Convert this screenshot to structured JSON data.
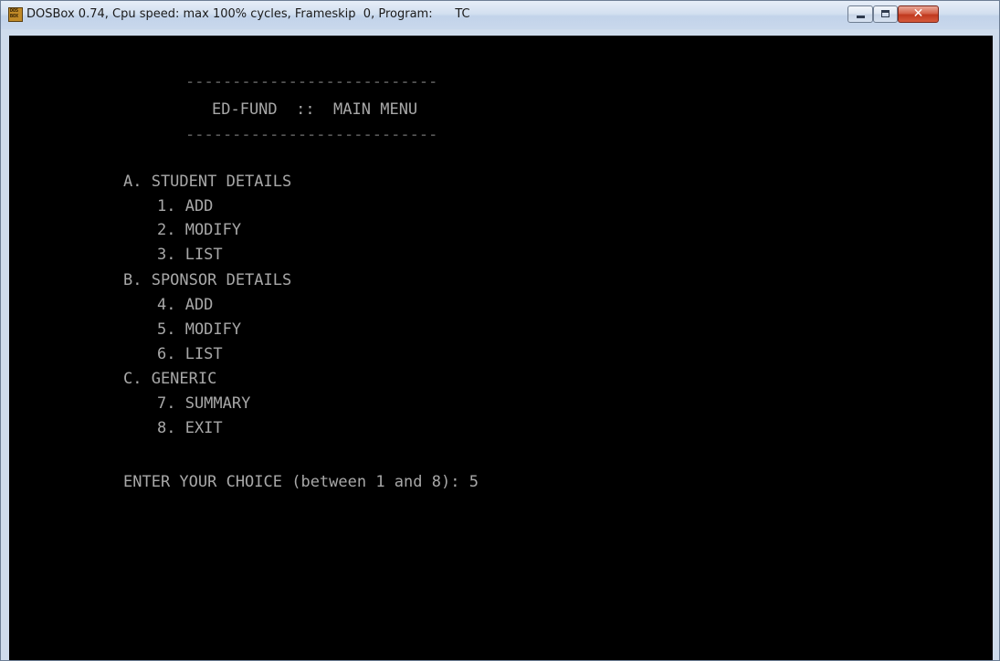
{
  "window": {
    "title": "DOSBox 0.74, Cpu speed: max 100% cycles, Frameskip  0, Program:      TC",
    "icon": "dosbox-icon",
    "icon_text_top": "DOS",
    "icon_text_bottom": "BOX",
    "controls": {
      "minimize": "minimize-icon",
      "maximize": "maximize-icon",
      "close": "close-icon",
      "close_glyph": "✕"
    }
  },
  "screen": {
    "rule_top": "---------------------------",
    "menu_title": "ED-FUND  ::  MAIN MENU",
    "rule_bottom": "---------------------------",
    "sections": [
      {
        "label": "A. STUDENT DETAILS",
        "items": [
          "1. ADD",
          "2. MODIFY",
          "3. LIST"
        ]
      },
      {
        "label": "B. SPONSOR DETAILS",
        "items": [
          "4. ADD",
          "5. MODIFY",
          "6. LIST"
        ]
      },
      {
        "label": "C. GENERIC",
        "items": [
          "7. SUMMARY",
          "8. EXIT"
        ]
      }
    ],
    "prompt": "ENTER YOUR CHOICE (between 1 and 8): 5"
  },
  "colors": {
    "screen_background": "#000000",
    "screen_text": "#a8a8a8",
    "titlebar": "#d3e0f0",
    "close_button": "#c0391f"
  }
}
